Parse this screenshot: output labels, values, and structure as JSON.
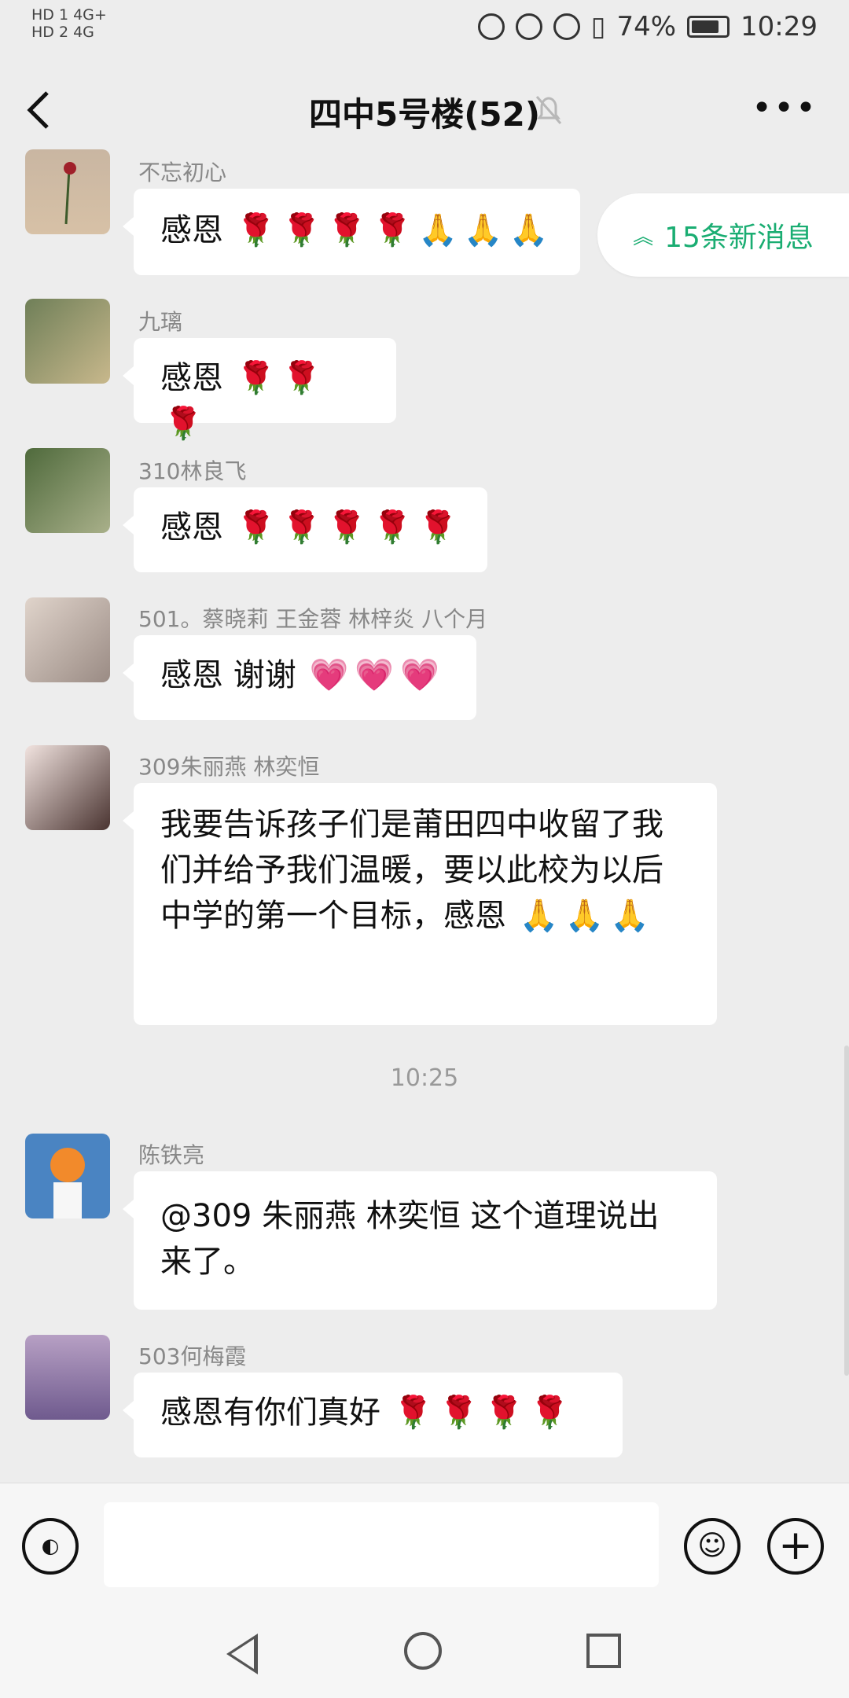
{
  "status_bar": {
    "left_line1": "HD 1 4G+",
    "left_line2": "HD 2 4G",
    "battery": "74%",
    "time": "10:29"
  },
  "header": {
    "title": "四中5号楼(52)"
  },
  "new_messages": {
    "label": "15条新消息"
  },
  "messages": [
    {
      "sender": "不忘初心",
      "text": "感恩"
    },
    {
      "sender": "九璃",
      "text": "感恩"
    },
    {
      "sender": "310林良飞",
      "text": "感恩"
    },
    {
      "sender": "501。蔡晓莉 王金蓉 林梓炎 八个月",
      "text": "感恩 谢谢"
    },
    {
      "sender": "309朱丽燕 林奕恒",
      "text": "我要告诉孩子们是莆田四中收留了我们并给予我们温暖，要以此校为以后中学的第一个目标，感恩"
    },
    {
      "sender": "陈铁亮",
      "text": "@309 朱丽燕 林奕恒  这个道理说出来了。"
    },
    {
      "sender": "503何梅霞",
      "text": "感恩有你们真好"
    }
  ],
  "timestamp": "10:25",
  "colors": {
    "accent": "#1aad72",
    "background": "#ededed"
  }
}
